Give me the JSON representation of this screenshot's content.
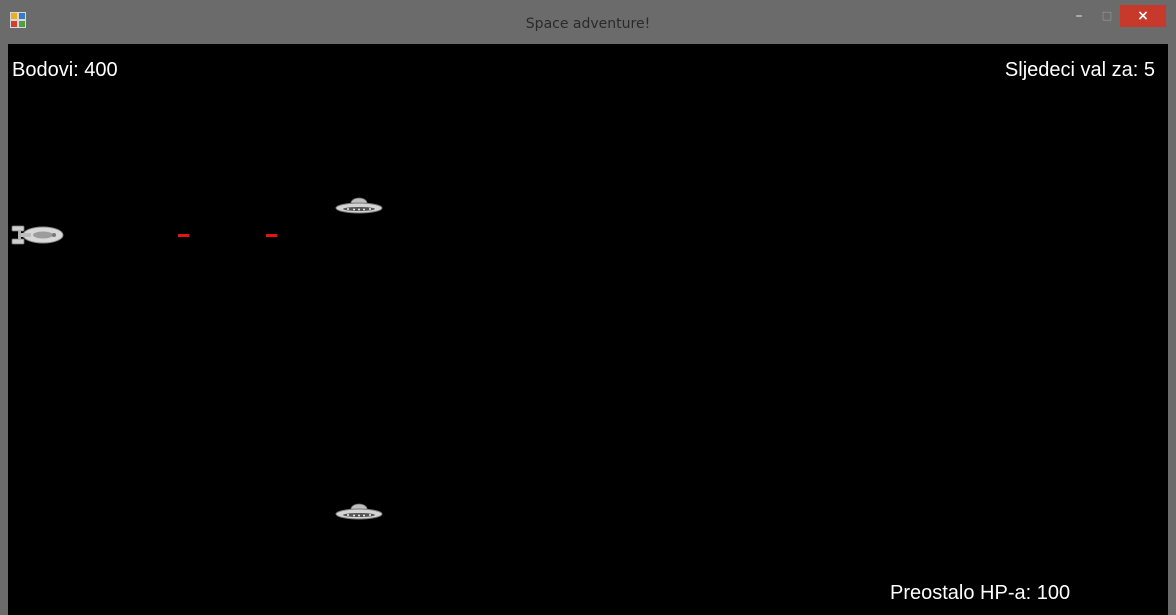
{
  "window": {
    "title": "Space adventure!",
    "controls": {
      "minimize": "–",
      "maximize": "□",
      "close": "×"
    },
    "close_color": "#c7392b"
  },
  "hud": {
    "score": "Bodovi: 400",
    "next_wave": "Sljedeci val za: 5",
    "hp_remaining": "Preostalo HP-a: 100"
  },
  "colors": {
    "background": "#000000",
    "hud_text": "#ffffff",
    "laser": "#e01515"
  },
  "sprites": {
    "player": "player-spaceship-icon",
    "enemy": "ufo-enemy-icon",
    "projectile": "red-laser-bolt"
  }
}
